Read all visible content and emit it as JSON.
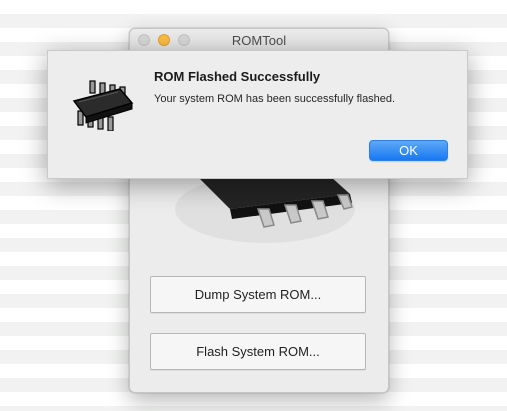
{
  "window": {
    "title": "ROMTool",
    "buttons": {
      "dump_label": "Dump System ROM...",
      "flash_label": "Flash System ROM..."
    }
  },
  "alert": {
    "icon": "chip-icon",
    "title": "ROM Flashed Successfully",
    "message": "Your system ROM has been successfully flashed.",
    "ok_label": "OK",
    "accent_color": "#1a7bf3"
  },
  "background_stripe_color": "#f1f2f1"
}
